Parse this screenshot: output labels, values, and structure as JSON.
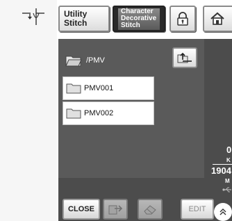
{
  "top_bar": {
    "utility_stitch_line1": "Utility",
    "utility_stitch_line2": "Stitch",
    "character_line1": "Character",
    "character_line2": "Decorative",
    "character_line3": "Stitch"
  },
  "browser": {
    "current_path": "/PMV",
    "items": [
      {
        "name": "PMV001"
      },
      {
        "name": "PMV002"
      }
    ]
  },
  "status": {
    "value1": "0",
    "label1": "K",
    "value2": "1904",
    "label2": "M"
  },
  "bottom_bar": {
    "close_label": "CLOSE",
    "edit_label": "EDIT"
  }
}
